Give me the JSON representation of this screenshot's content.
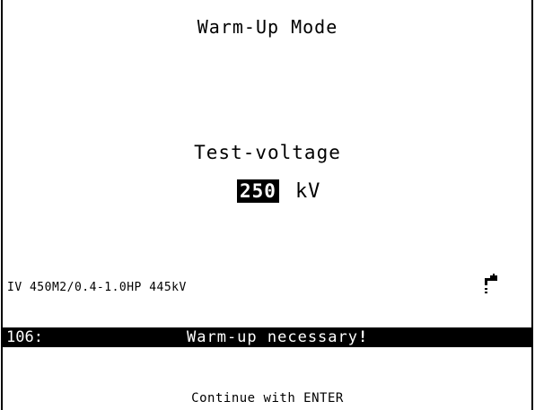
{
  "screen": {
    "title": "Warm-Up Mode",
    "test_voltage": {
      "label": "Test-voltage",
      "value": "250",
      "unit": "kV"
    },
    "device_info": "IV 450M2/0.4-1.0HP 445kV",
    "status_icon": "water-tap-icon",
    "message": {
      "code": "106:",
      "text": "Warm-up necessary",
      "emphasis": "!"
    },
    "prompt": "Continue with ENTER"
  },
  "colors": {
    "background": "#ffffff",
    "foreground": "#000000",
    "highlight_bg": "#000000",
    "highlight_fg": "#ffffff"
  }
}
